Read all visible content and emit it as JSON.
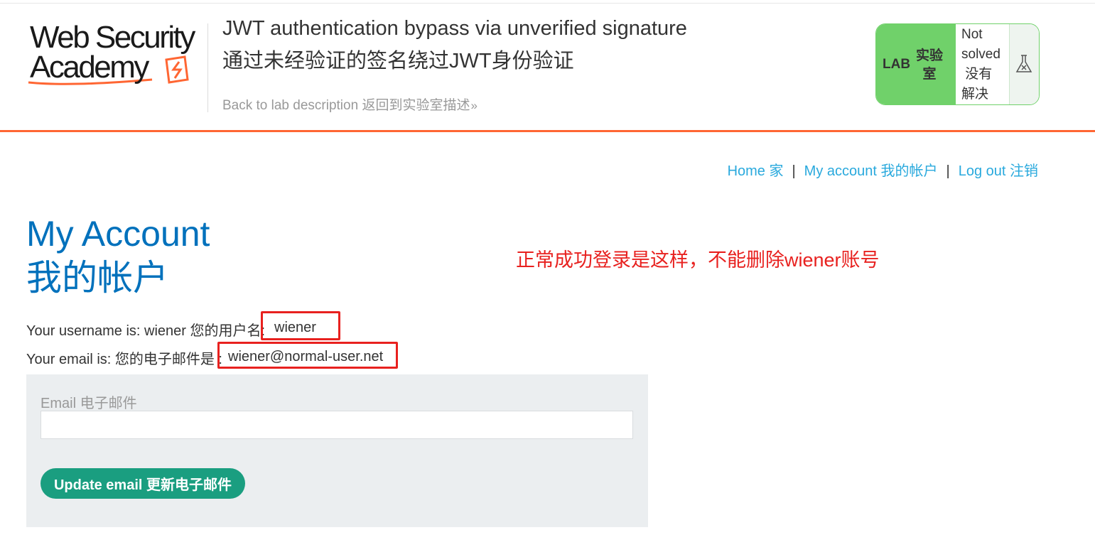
{
  "header": {
    "logo": {
      "line1": "Web Security",
      "line2": "Academy"
    },
    "title_en": "JWT authentication bypass via unverified signature",
    "title_zh": "通过未经验证的签名绕过JWT身份验证",
    "back_link": "Back to lab description 返回到实验室描述",
    "back_chevron": "»",
    "lab_badge": {
      "lab": "LAB",
      "lab_zh": "实验室",
      "status_lines": [
        "Not",
        "solved",
        " 没有",
        "解决"
      ],
      "icon": "flask-icon",
      "color": "#70d16a"
    },
    "accent_color": "#ff6633"
  },
  "nav": {
    "home": "Home 家",
    "my_account": "My account 我的帐户",
    "logout": "Log out 注销",
    "separator": "|"
  },
  "main": {
    "title_en": "My Account",
    "title_zh": "我的帐户",
    "annotation": "正常成功登录是这样，不能删除wiener账号",
    "username_label": "Your username is: wiener 您的用户名:",
    "username_value": "wiener",
    "email_label": "Your email is: 您的电子邮件是 :",
    "email_value": "wiener@normal-user.net",
    "form": {
      "email_label": "Email 电子邮件",
      "email_value": "",
      "update_button": "Update email 更新电子邮件"
    }
  }
}
